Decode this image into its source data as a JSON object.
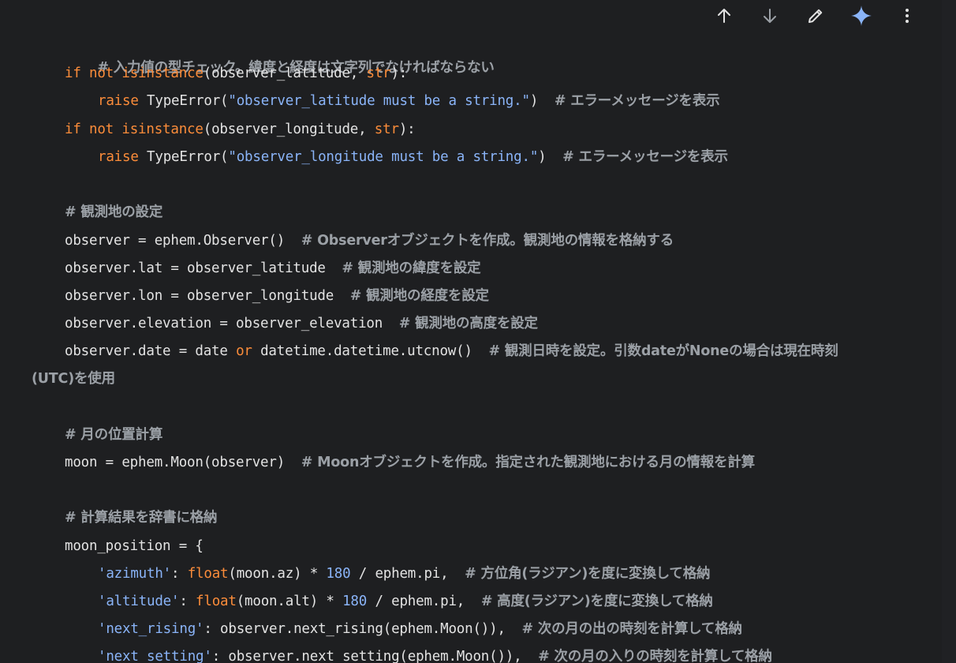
{
  "toolbar": {
    "icons": [
      "arrow-up-icon",
      "arrow-down-icon",
      "pencil-icon",
      "sparkle-icon",
      "more-vert-icon"
    ],
    "sparkle_color": "#8ab4f8"
  },
  "colors": {
    "keyword": "#fb8c3a",
    "string": "#8ab4f8",
    "comment": "#9ba0a6",
    "text": "#e3e3e3",
    "background": "#1e1f21"
  },
  "code": {
    "l1": {
      "cm": "# 入力値の型チェック。緯度と経度は文字列でなければならない"
    },
    "l2": {
      "kw1": "if",
      "sp1": " ",
      "kw2": "not",
      "sp2": " ",
      "fn": "isinstance",
      "t1": "(observer_latitude, ",
      "bi": "str",
      "t2": "):"
    },
    "l3": {
      "kw": "raise",
      "t1": " TypeError(",
      "st": "\"observer_latitude must be a string.\"",
      "t2": ")  ",
      "cm": "# エラーメッセージを表示"
    },
    "l4": {
      "kw1": "if",
      "sp1": " ",
      "kw2": "not",
      "sp2": " ",
      "fn": "isinstance",
      "t1": "(observer_longitude, ",
      "bi": "str",
      "t2": "):"
    },
    "l5": {
      "kw": "raise",
      "t1": " TypeError(",
      "st": "\"observer_longitude must be a string.\"",
      "t2": ")  ",
      "cm": "# エラーメッセージを表示"
    },
    "l6": {
      "cm": "# 観測地の設定"
    },
    "l7": {
      "t": "observer = ephem.Observer()  ",
      "cm": "# Observerオブジェクトを作成。観測地の情報を格納する"
    },
    "l8": {
      "t": "observer.lat = observer_latitude  ",
      "cm": "# 観測地の緯度を設定"
    },
    "l9": {
      "t": "observer.lon = observer_longitude  ",
      "cm": "# 観測地の経度を設定"
    },
    "l10": {
      "t": "observer.elevation = observer_elevation  ",
      "cm": "# 観測地の高度を設定"
    },
    "l11": {
      "t1": "observer.date = date ",
      "kw": "or",
      "t2": " datetime.datetime.utcnow()  ",
      "cm": "# 観測日時を設定。引数dateがNoneの場合は現在時刻"
    },
    "l12": {
      "cm": "(UTC)を使用"
    },
    "l13": {
      "cm": "# 月の位置計算"
    },
    "l14": {
      "t": "moon = ephem.Moon(observer)  ",
      "cm": "# Moonオブジェクトを作成。指定された観測地における月の情報を計算"
    },
    "l15": {
      "cm": "# 計算結果を辞書に格納"
    },
    "l16": {
      "t": "moon_position = {"
    },
    "l17": {
      "st": "'azimuth'",
      "t1": ": ",
      "bi": "float",
      "t2": "(moon.az) * ",
      "nu": "180",
      "t3": " / ephem.pi,  ",
      "cm": "# 方位角(ラジアン)を度に変換して格納"
    },
    "l18": {
      "st": "'altitude'",
      "t1": ": ",
      "bi": "float",
      "t2": "(moon.alt) * ",
      "nu": "180",
      "t3": " / ephem.pi,  ",
      "cm": "# 高度(ラジアン)を度に変換して格納"
    },
    "l19": {
      "st": "'next_rising'",
      "t1": ": observer.next_rising(ephem.Moon()),  ",
      "cm": "# 次の月の出の時刻を計算して格納"
    },
    "l20": {
      "st": "'next_setting'",
      "t1": ": observer.next_setting(ephem.Moon()),  ",
      "cm": "# 次の月の入りの時刻を計算して格納"
    }
  }
}
